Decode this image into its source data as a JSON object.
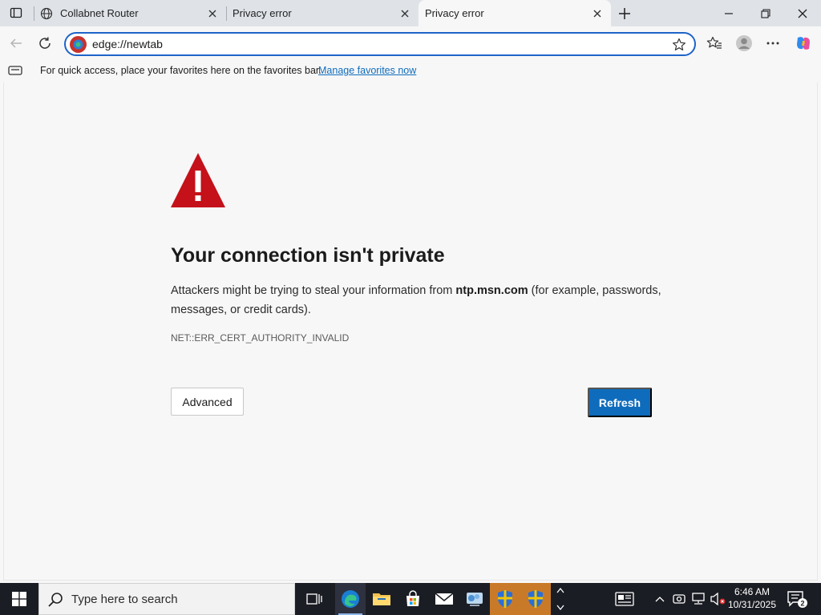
{
  "browser": {
    "tabs": [
      {
        "title": "Collabnet Router",
        "icon": "globe-icon"
      },
      {
        "title": "Privacy error",
        "icon": "none"
      },
      {
        "title": "Privacy error",
        "icon": "none",
        "active": true
      }
    ],
    "address": "edge://newtab",
    "favorites_bar": {
      "message": "For quick access, place your favorites here on the favorites bar.",
      "link": "Manage favorites now"
    }
  },
  "page": {
    "title": "Your connection isn't private",
    "desc_before": "Attackers might be trying to steal your information from ",
    "host": "ntp.msn.com",
    "desc_after": " (for example, passwords, messages, or credit cards).",
    "error_code": "NET::ERR_CERT_AUTHORITY_INVALID",
    "advanced_label": "Advanced",
    "refresh_label": "Refresh"
  },
  "taskbar": {
    "search_placeholder": "Type here to search",
    "time": "6:46 AM",
    "date": "10/31/2025",
    "notification_count": "2"
  },
  "colors": {
    "accent": "#0f6cbd",
    "warning_red": "#c4111a",
    "address_border": "#1e64c8"
  }
}
